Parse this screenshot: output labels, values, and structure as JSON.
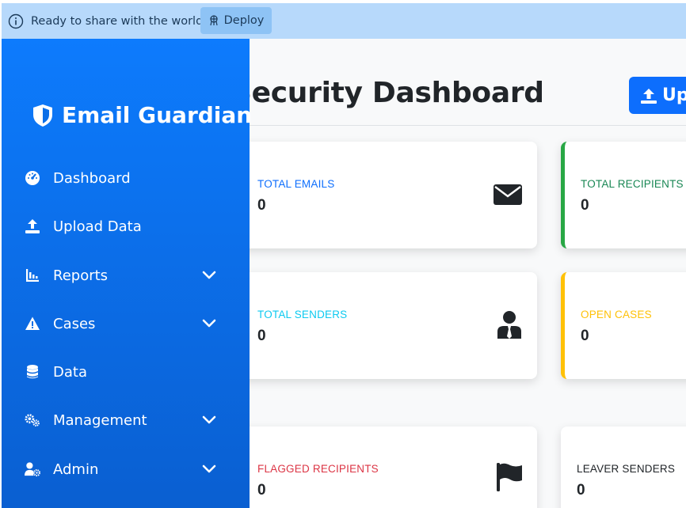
{
  "banner": {
    "message": "Ready to share with the world?",
    "deploy_label": "Deploy"
  },
  "sidebar": {
    "brand": "Email Guardian",
    "items": [
      {
        "label": "Dashboard",
        "icon": "dashboard-gauge-icon",
        "has_submenu": false
      },
      {
        "label": "Upload Data",
        "icon": "upload-icon",
        "has_submenu": false
      },
      {
        "label": "Reports",
        "icon": "chart-icon",
        "has_submenu": true
      },
      {
        "label": "Cases",
        "icon": "warning-icon",
        "has_submenu": true
      },
      {
        "label": "Data",
        "icon": "database-icon",
        "has_submenu": false
      },
      {
        "label": "Management",
        "icon": "gears-icon",
        "has_submenu": true
      },
      {
        "label": "Admin",
        "icon": "user-cog-icon",
        "has_submenu": true
      }
    ]
  },
  "header": {
    "title": "Security Dashboard",
    "upload_label": "Upl"
  },
  "cards": [
    {
      "label": "TOTAL EMAILS",
      "value": "0",
      "color": "#0d6efd",
      "icon": "envelope-icon"
    },
    {
      "label": "TOTAL RECIPIENTS",
      "value": "0",
      "color": "#198754",
      "icon": "users-icon"
    },
    {
      "label": "TOTAL SENDERS",
      "value": "0",
      "color": "#0dcaf0",
      "icon": "user-tie-icon"
    },
    {
      "label": "OPEN CASES",
      "value": "0",
      "color": "#ffc107",
      "icon": "folder-icon"
    },
    {
      "label": "FLAGGED RECIPIENTS",
      "value": "0",
      "color": "#dc3545",
      "icon": "flag-icon"
    },
    {
      "label": "LEAVER SENDERS",
      "value": "0",
      "color": "#212529",
      "icon": "user-minus-icon"
    }
  ],
  "colors": {
    "sidebar_top": "#0d7bfd",
    "sidebar_bottom": "#0a5fd1",
    "primary": "#0d6efd",
    "banner": "#b7d9fb"
  }
}
